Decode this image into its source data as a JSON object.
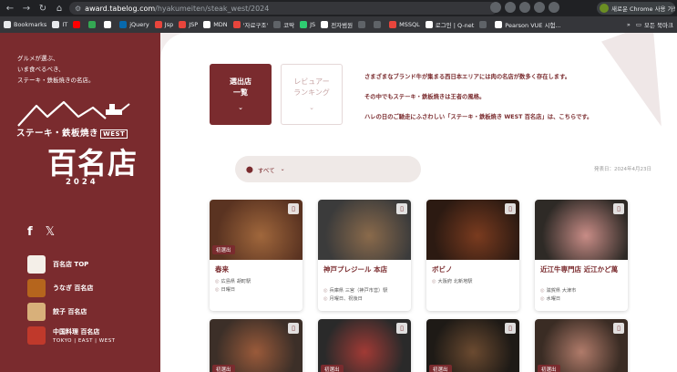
{
  "browser": {
    "url_host": "award.tabelog.com",
    "url_path": "/hyakumeiten/steak_west/2024",
    "profile_label": "새로운 Chrome 사용 가능 :",
    "bookmarks": [
      {
        "label": "Bookmarks",
        "color": "#e8eaed"
      },
      {
        "label": "IT",
        "color": "#e8eaed"
      },
      {
        "label": "",
        "color": "#ff0000"
      },
      {
        "label": "",
        "color": "#34a853"
      },
      {
        "label": "",
        "color": "#ffffff"
      },
      {
        "label": "jQuery",
        "color": "#0769ad"
      },
      {
        "label": "Jsp",
        "color": "#e8453c"
      },
      {
        "label": "JSP",
        "color": "#e8453c"
      },
      {
        "label": "MDN",
        "color": "#ffffff"
      },
      {
        "label": "'자료구조'",
        "color": "#e8453c"
      },
      {
        "label": "코딱",
        "color": "#5f6368"
      },
      {
        "label": "JS",
        "color": "#2ecc71"
      },
      {
        "label": "전자범원",
        "color": "#ffffff"
      },
      {
        "label": "",
        "color": "#5f6368"
      },
      {
        "label": "",
        "color": "#5f6368"
      },
      {
        "label": "MSSQL",
        "color": "#e8453c"
      },
      {
        "label": "로그인 | Q-net",
        "color": "#ffffff"
      },
      {
        "label": "",
        "color": "#5f6368"
      },
      {
        "label": "Pearson VUE 시험...",
        "color": "#ffffff"
      }
    ],
    "all_bookmarks": "모든 북마크"
  },
  "sidebar": {
    "tagline": [
      "グルメが選ぶ、",
      "いま食べるべき、",
      "ステーキ・鉄板焼きの名店。"
    ],
    "logo_sub": "ステーキ・鉄板焼き",
    "logo_west": "WEST",
    "logo_big": "百名店",
    "logo_year": "2024",
    "social": {
      "facebook": "f",
      "x": "𝕏"
    },
    "links": [
      {
        "label": "百名店 TOP",
        "sub": ""
      },
      {
        "label": "うなぎ 百名店",
        "sub": ""
      },
      {
        "label": "餃子 百名店",
        "sub": ""
      },
      {
        "label": "中国料理 百名店",
        "sub": "TOKYO | EAST | WEST"
      }
    ]
  },
  "main": {
    "btn_primary": [
      "選出店",
      "一覧"
    ],
    "btn_secondary": [
      "レビュアー",
      "ランキング"
    ],
    "intro": [
      "さまざまなブランド牛が集まる西日本エリアには肉の名店が数多く存在します。",
      "その中でもステーキ・鉄板焼きは王者の風格。",
      "ハレの日のご馳走にふさわしい「ステーキ・鉄板焼き WEST 百名店」は、こちらです。"
    ],
    "filter_label": "すべて",
    "pubdate": "発表日：2024年4月23日",
    "badge": "初選出",
    "cards": [
      {
        "name": "春来",
        "loc": "広島県 胡町駅",
        "day": "日曜日",
        "c1": "#5a3321",
        "c2": "#a0673c",
        "badge": true
      },
      {
        "name": "神戸プレジール 本店",
        "loc": "兵庫県 三宮（神戸市営）駅",
        "day": "月曜日、祝後日",
        "c1": "#3b3b3b",
        "c2": "#8a6a4b",
        "badge": false
      },
      {
        "name": "ボビノ",
        "loc": "大阪府 北新地駅",
        "day": "",
        "c1": "#2c1a12",
        "c2": "#7a3b1f",
        "badge": false
      },
      {
        "name": "近江牛専門店 近江かど萬",
        "loc": "滋賀県 大津市",
        "day": "水曜日",
        "c1": "#2e2a26",
        "c2": "#c88c86",
        "badge": false
      }
    ],
    "row2": [
      {
        "c1": "#3c2f28",
        "c2": "#9a5a3a",
        "badge": true
      },
      {
        "c1": "#2a2a2a",
        "c2": "#a13a35",
        "badge": true
      },
      {
        "c1": "#1e1a16",
        "c2": "#6b4a30",
        "badge": true
      },
      {
        "c1": "#3a2c24",
        "c2": "#b07b6a",
        "badge": true
      }
    ]
  },
  "colors": {
    "brand": "#7a2b2e",
    "panel_bg": "#f3eded"
  }
}
